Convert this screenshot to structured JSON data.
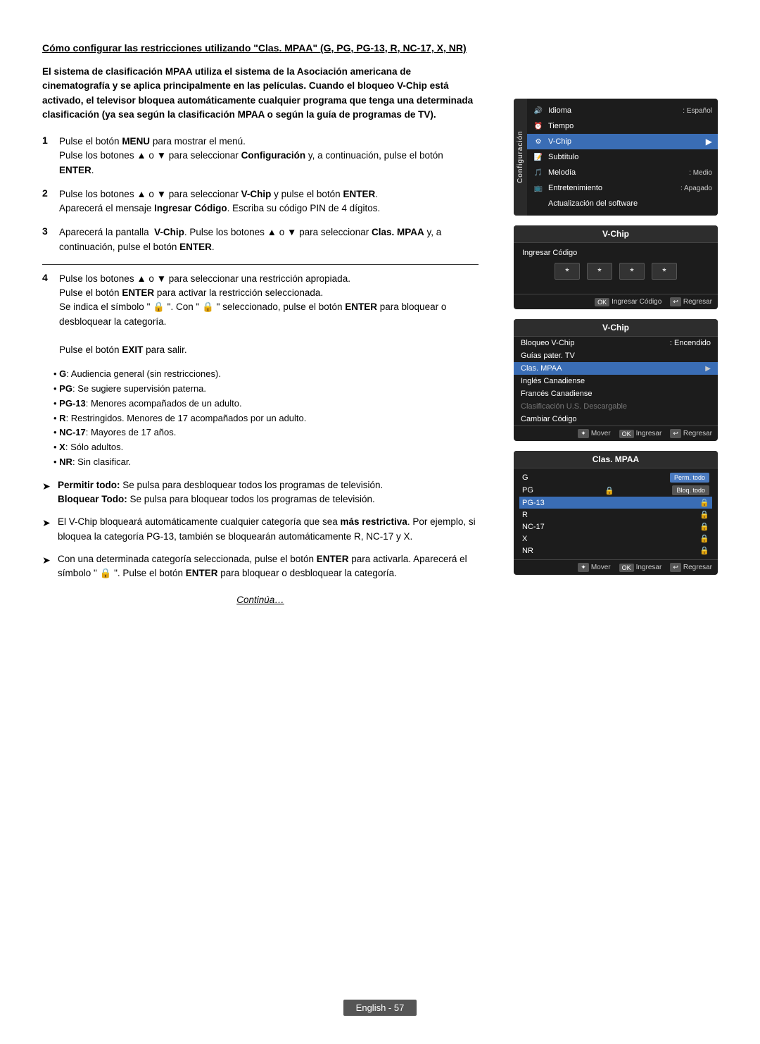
{
  "page": {
    "title": "Cómo configurar las restricciones utilizando \"Clas. MPAA\" (G, PG, PG-13, R, NC-17, X, NR)",
    "intro_bold": "El sistema de clasificación MPAA utiliza el sistema de la Asociación americana de cinematografía y se aplica principalmente en las películas. Cuando el bloqueo V-Chip está activado, el televisor bloquea automáticamente cualquier programa que tenga una determinada clasificación (ya sea según la clasificación MPAA o según la guía de programas de TV).",
    "steps": [
      {
        "num": "1",
        "text": "Pulse el botón MENU para mostrar el menú.",
        "sub": "Pulse los botones ▲ o ▼ para seleccionar Configuración y, a continuación, pulse el botón ENTER."
      },
      {
        "num": "2",
        "text": "Pulse los botones ▲ o ▼ para seleccionar V-Chip y pulse el botón ENTER.",
        "sub": "Aparecerá el mensaje Ingresar Código. Escriba su código PIN de 4 dígitos."
      },
      {
        "num": "3",
        "text": "Aparecerá la pantalla  V-Chip. Pulse los botones ▲ o ▼ para seleccionar Clas. MPAA y, a continuación, pulse el botón ENTER."
      },
      {
        "num": "4",
        "text": "Pulse los botones ▲ o ▼ para seleccionar una restricción apropiada.",
        "sub1": "Pulse el botón ENTER para activar la restricción seleccionada.",
        "sub2": "Se indica el símbolo \" 🔒 \". Con \" 🔒 \" seleccionado, pulse el botón ENTER para bloquear o desbloquear la categoría.",
        "sub3": "Pulse el botón EXIT para salir."
      }
    ],
    "bullets": [
      "G: Audiencia general (sin restricciones).",
      "PG: Se sugiere supervisión paterna.",
      "PG-13: Menores acompañados de un adulto.",
      "R: Restringidos. Menores de 17 acompañados por un adulto.",
      "NC-17: Mayores de 17 años.",
      "X: Sólo adultos.",
      "NR: Sin clasificar."
    ],
    "arrow_points": [
      {
        "prefix": "Permitir todo:",
        "text": " Se pulsa para desbloquear todos los programas de televisión."
      },
      {
        "prefix": "Bloquear Todo:",
        "text": " Se pulsa para bloquear todos los programas de televisión."
      },
      {
        "text": "El V-Chip bloqueará automáticamente cualquier categoría que sea más restrictiva. Por ejemplo, si bloquea la categoría PG-13, también se bloquearán automáticamente R, NC-17 y X."
      },
      {
        "text": "Con una determinada categoría seleccionada, pulse el botón ENTER para activarla. Aparecerá el símbolo \" 🔒 \". Pulse el botón ENTER para bloquear o desbloquear la categoría."
      }
    ],
    "continua": "Continúa…",
    "footer": "English - 57",
    "ui_panels": {
      "panel1_title": "Configuración",
      "panel1_items": [
        {
          "icon": "🔊",
          "label": "Idioma",
          "value": ": Español"
        },
        {
          "icon": "⏰",
          "label": "Tiempo",
          "value": ""
        },
        {
          "icon": "⚙",
          "label": "V-Chip",
          "value": "",
          "active": true
        },
        {
          "icon": "📝",
          "label": "Subtítulo",
          "value": ""
        },
        {
          "icon": "🎵",
          "label": "Melodía",
          "value": ": Medio"
        },
        {
          "icon": "📺",
          "label": "Entretenimiento",
          "value": ": Apagado"
        },
        {
          "icon": "",
          "label": "Actualización del software",
          "value": ""
        }
      ],
      "panel2_title": "V-Chip",
      "panel2_label": "Ingresar Código",
      "panel2_footer_items": [
        "Ingresar Código",
        "Regresar"
      ],
      "panel3_title": "V-Chip",
      "panel3_items": [
        {
          "label": "Bloqueo V-Chip",
          "value": ": Encendido"
        },
        {
          "label": "Guías pater. TV",
          "value": ""
        },
        {
          "label": "Clas. MPAA",
          "value": "",
          "active": true,
          "has_arrow": true
        },
        {
          "label": "Inglés Canadiense",
          "value": ""
        },
        {
          "label": "Francés Canadiense",
          "value": ""
        },
        {
          "label": "Clasificación U.S. Descargable",
          "value": "",
          "dimmed": true
        },
        {
          "label": "Cambiar Código",
          "value": ""
        }
      ],
      "panel3_footer": [
        "Mover",
        "Ingresar",
        "Regresar"
      ],
      "panel4_title": "Clas. MPAA",
      "panel4_items": [
        {
          "label": "G",
          "locked": false
        },
        {
          "label": "PG",
          "locked": true
        },
        {
          "label": "PG-13",
          "locked": true
        },
        {
          "label": "R",
          "locked": true
        },
        {
          "label": "NC-17",
          "locked": true
        },
        {
          "label": "X",
          "locked": true
        },
        {
          "label": "NR",
          "locked": true
        }
      ],
      "panel4_btn1": "Perm. todo",
      "panel4_btn2": "Bloq. todo",
      "panel4_footer": [
        "Mover",
        "Ingresar",
        "Regresar"
      ]
    }
  }
}
